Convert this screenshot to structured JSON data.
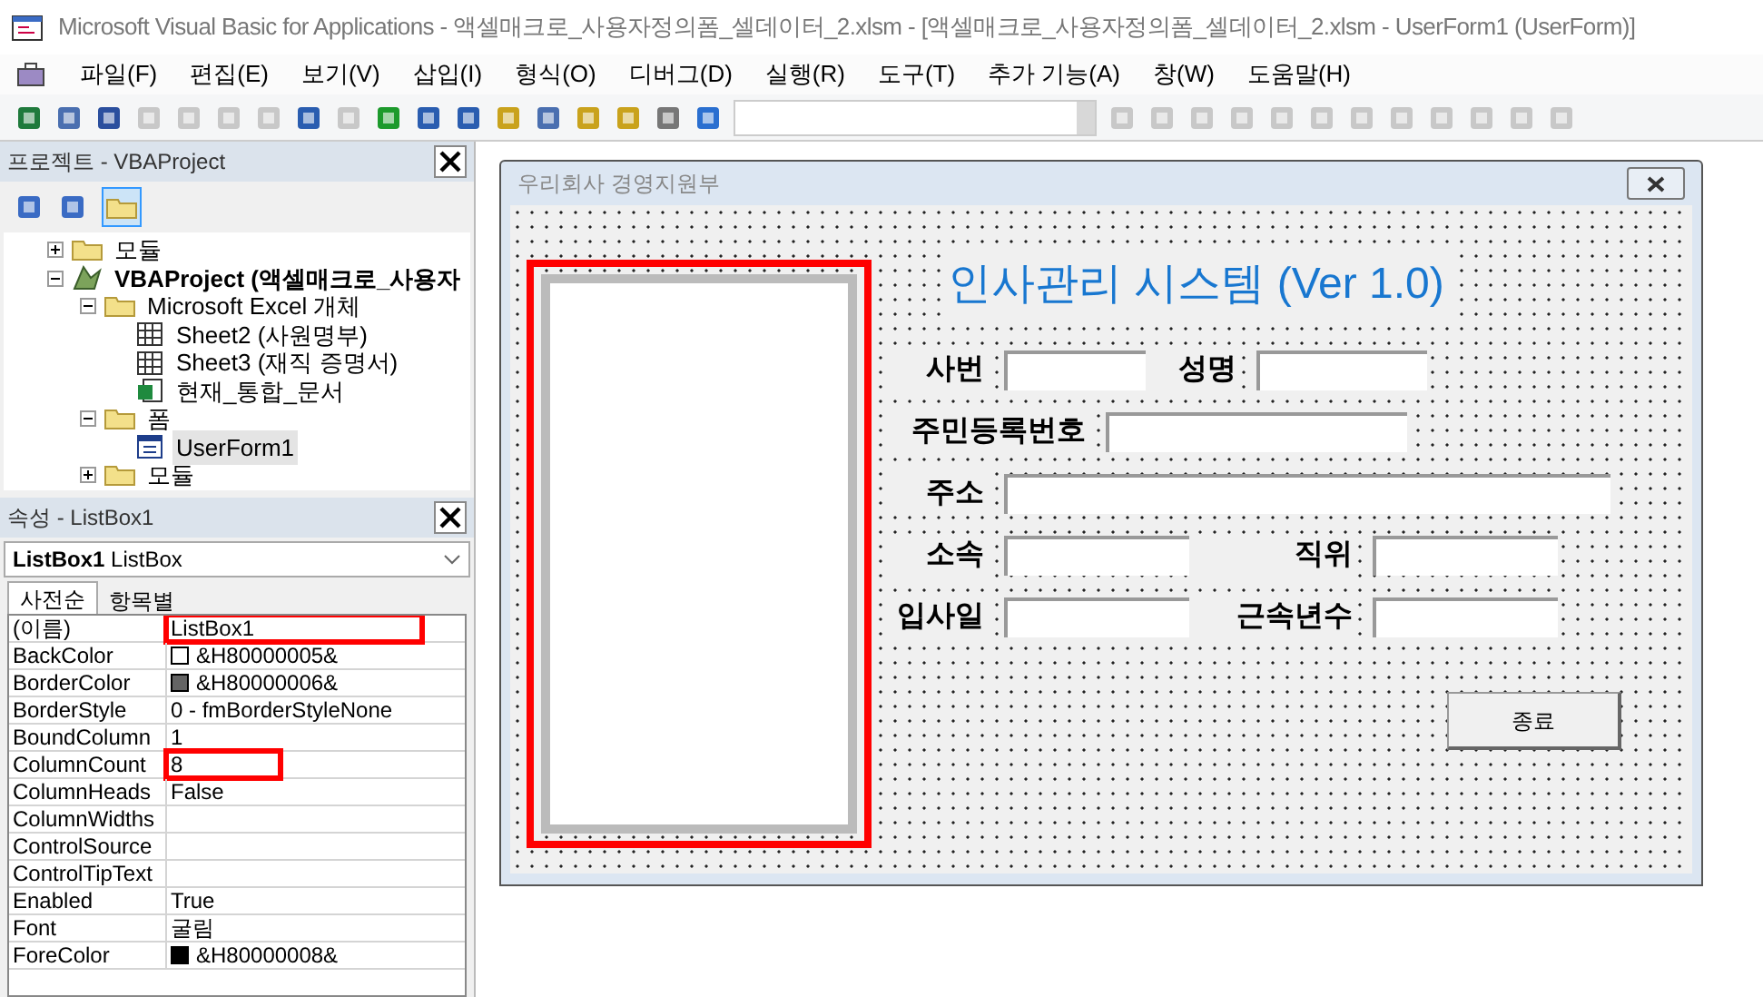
{
  "window": {
    "title": "Microsoft Visual Basic for Applications - 액셀매크로_사용자정의폼_셀데이터_2.xlsm - [액셀매크로_사용자정의폼_셀데이터_2.xlsm - UserForm1 (UserForm)]"
  },
  "menu": [
    "파일(F)",
    "편집(E)",
    "보기(V)",
    "삽입(I)",
    "형식(O)",
    "디버그(D)",
    "실행(R)",
    "도구(T)",
    "추가 기능(A)",
    "창(W)",
    "도움말(H)"
  ],
  "project_pane": {
    "title": "프로젝트 - VBAProject",
    "tree": [
      {
        "label": "모듈",
        "kind": "folder",
        "expanded": false,
        "bold": false
      },
      {
        "label": "VBAProject (액셀매크로_사용자",
        "kind": "project",
        "expanded": true,
        "bold": true,
        "children": [
          {
            "label": "Microsoft Excel 개체",
            "kind": "folder",
            "expanded": true,
            "bold": false,
            "children": [
              {
                "label": "Sheet2 (사원명부)",
                "kind": "sheet",
                "bold": false
              },
              {
                "label": "Sheet3 (재직 증명서)",
                "kind": "sheet",
                "bold": false
              },
              {
                "label": "현재_통합_문서",
                "kind": "workbook",
                "bold": false
              }
            ]
          },
          {
            "label": "폼",
            "kind": "folder",
            "expanded": true,
            "bold": false,
            "children": [
              {
                "label": "UserForm1",
                "kind": "form",
                "selected": true,
                "bold": false
              }
            ]
          },
          {
            "label": "모듈",
            "kind": "folder",
            "expanded": false,
            "bold": false
          }
        ]
      }
    ]
  },
  "properties_pane": {
    "title": "속성 - ListBox1",
    "object_name": "ListBox1",
    "object_type": "ListBox",
    "tabs": [
      {
        "label": "사전순",
        "selected": true
      },
      {
        "label": "항목별",
        "selected": false
      }
    ],
    "rows": [
      {
        "name": "(이름)",
        "value": "ListBox1",
        "highlighted": true
      },
      {
        "name": "BackColor",
        "value": "&H80000005&",
        "color": "#ffffff",
        "highlighted": false
      },
      {
        "name": "BorderColor",
        "value": "&H80000006&",
        "color": "#646464",
        "highlighted": false
      },
      {
        "name": "BorderStyle",
        "value": "0 - fmBorderStyleNone",
        "highlighted": false
      },
      {
        "name": "BoundColumn",
        "value": "1",
        "highlighted": false
      },
      {
        "name": "ColumnCount",
        "value": "8",
        "highlighted": true
      },
      {
        "name": "ColumnHeads",
        "value": "False",
        "highlighted": false
      },
      {
        "name": "ColumnWidths",
        "highlighted": false
      },
      {
        "name": "ControlSource",
        "highlighted": false
      },
      {
        "name": "ControlTipText",
        "highlighted": false
      },
      {
        "name": "Enabled",
        "value": "True",
        "highlighted": false
      },
      {
        "name": "Font",
        "value": "굴림",
        "highlighted": false
      },
      {
        "name": "ForeColor",
        "value": "&H80000008&",
        "color": "#000000",
        "highlighted": false
      }
    ]
  },
  "user_form": {
    "title": "우리회사 경영지원부",
    "listbox_highlighted": true,
    "heading": "인사관리 시스템 (Ver 1.0)",
    "rows": [
      [
        {
          "label": "사번"
        },
        {
          "label": "성명"
        }
      ],
      [
        {
          "label": "주민등록번호"
        }
      ],
      [
        {
          "label": "주소"
        }
      ],
      [
        {
          "label": "소속"
        },
        {
          "label": "직위"
        }
      ],
      [
        {
          "label": "입사일"
        },
        {
          "label": "근속년수"
        }
      ]
    ],
    "close_button": "종료"
  }
}
